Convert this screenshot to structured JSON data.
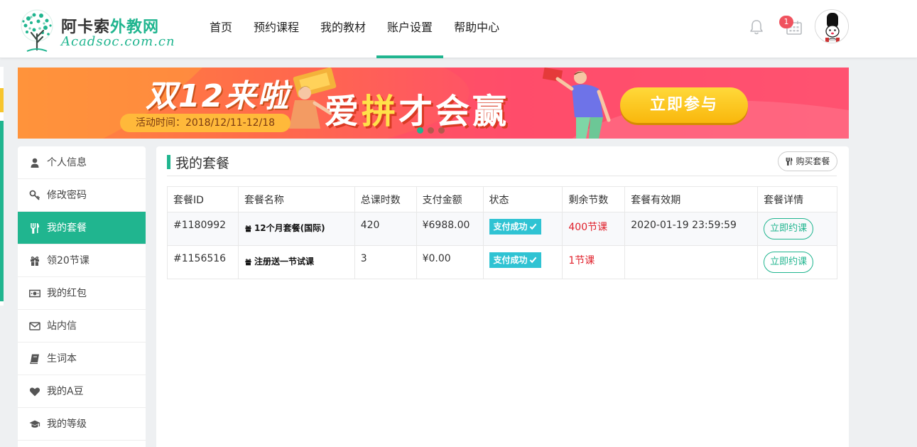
{
  "header": {
    "logo": {
      "title_part1": "阿卡索",
      "title_part2": "外教网",
      "subtitle": "Acadsoc.com.cn"
    },
    "nav": [
      {
        "label": "首页",
        "active": false
      },
      {
        "label": "预约课程",
        "active": false
      },
      {
        "label": "我的教材",
        "active": false
      },
      {
        "label": "账户设置",
        "active": true
      },
      {
        "label": "帮助中心",
        "active": false
      }
    ],
    "notification_badge": "1",
    "icons": {
      "notifications": "bell-icon",
      "schedule": "calendar-icon",
      "user": "avatar"
    }
  },
  "banner": {
    "headline": "双12来啦",
    "date_text": "活动时间：2018/12/11-12/18",
    "slogan_a": "爱",
    "slogan_b": "拼",
    "slogan_c": "才会赢",
    "cta_label": "立即参与",
    "slides": 3,
    "active_slide": 1
  },
  "sidebar": {
    "items": [
      {
        "label": "个人信息",
        "icon": "user-icon"
      },
      {
        "label": "修改密码",
        "icon": "key-icon"
      },
      {
        "label": "我的套餐",
        "icon": "utensils-icon",
        "active": true
      },
      {
        "label": "领20节课",
        "icon": "gift-icon"
      },
      {
        "label": "我的红包",
        "icon": "money-icon"
      },
      {
        "label": "站内信",
        "icon": "envelope-icon"
      },
      {
        "label": "生词本",
        "icon": "book-icon"
      },
      {
        "label": "我的A豆",
        "icon": "heart-icon"
      },
      {
        "label": "我的等级",
        "icon": "graduation-cap-icon"
      }
    ]
  },
  "main": {
    "title": "我的套餐",
    "buy_label": "购买套餐",
    "table": {
      "columns": [
        "套餐ID",
        "套餐名称",
        "总课时数",
        "支付金额",
        "状态",
        "剩余节数",
        "套餐有效期",
        "套餐详情"
      ],
      "rows": [
        {
          "id": "#1180992",
          "name": "12个月套餐(国际)",
          "hours": "420",
          "amount": "¥6988.00",
          "status": "支付成功",
          "remaining": "400节课",
          "expiry": "2020-01-19 23:59:59",
          "action": "立即约课"
        },
        {
          "id": "#1156516",
          "name": "注册送一节试课",
          "hours": "3",
          "amount": "¥0.00",
          "status": "支付成功",
          "remaining": "1节课",
          "expiry": "",
          "action": "立即约课"
        }
      ]
    }
  },
  "colors": {
    "brand": "#20b58f",
    "status": "#2fc3d3",
    "remaining": "#e0202b",
    "badge": "#f0525e"
  }
}
